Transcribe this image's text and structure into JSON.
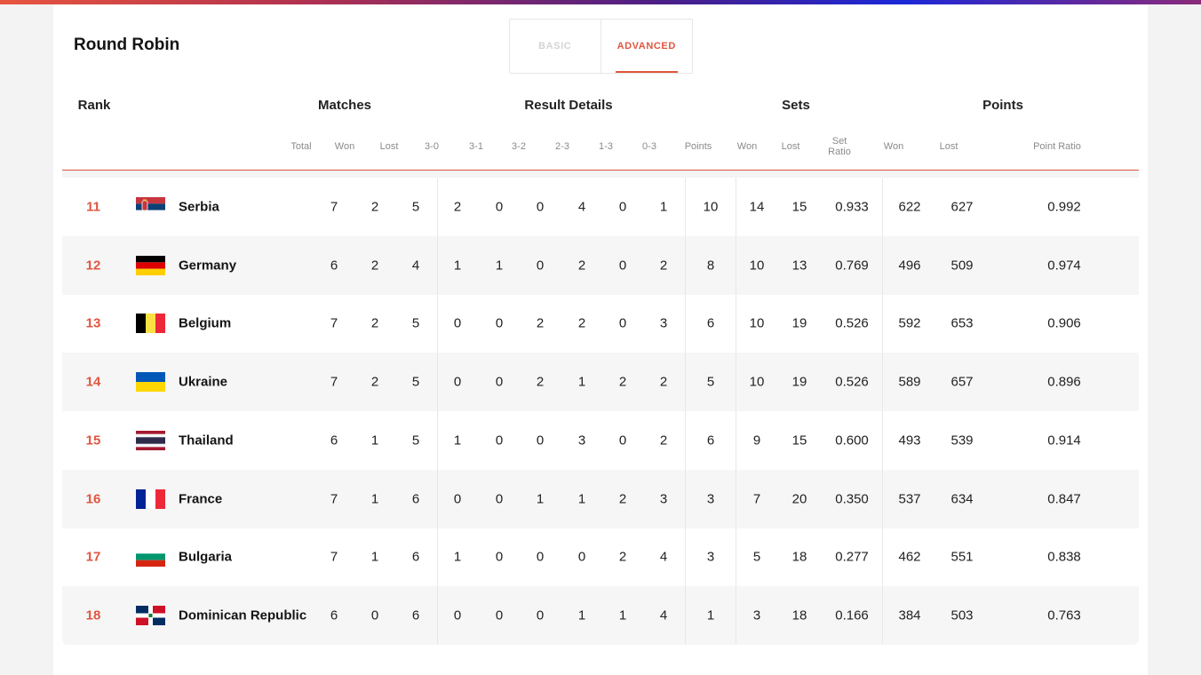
{
  "title": "Round Robin",
  "tabs": {
    "basic": "BASIC",
    "advanced": "ADVANCED"
  },
  "groups": {
    "rank": "Rank",
    "matches": "Matches",
    "result_details": "Result Details",
    "sets": "Sets",
    "points": "Points"
  },
  "columns": {
    "total": "Total",
    "won": "Won",
    "lost": "Lost",
    "r30": "3-0",
    "r31": "3-1",
    "r32": "3-2",
    "r23": "2-3",
    "r13": "1-3",
    "r03": "0-3",
    "points": "Points",
    "sets_won": "Won",
    "sets_lost": "Lost",
    "set_ratio_1": "Set",
    "set_ratio_2": "Ratio",
    "points_won": "Won",
    "points_lost": "Lost",
    "point_ratio": "Point Ratio"
  },
  "rows": [
    {
      "rank": "11",
      "flag": "serbia-flag-icon",
      "team": "Serbia",
      "total": "7",
      "won": "2",
      "lost": "5",
      "r30": "2",
      "r31": "0",
      "r32": "0",
      "r23": "4",
      "r13": "0",
      "r03": "1",
      "points": "10",
      "sets_won": "14",
      "sets_lost": "15",
      "set_ratio": "0.933",
      "points_won": "622",
      "points_lost": "627",
      "point_ratio": "0.992"
    },
    {
      "rank": "12",
      "flag": "germany-flag-icon",
      "team": "Germany",
      "total": "6",
      "won": "2",
      "lost": "4",
      "r30": "1",
      "r31": "1",
      "r32": "0",
      "r23": "2",
      "r13": "0",
      "r03": "2",
      "points": "8",
      "sets_won": "10",
      "sets_lost": "13",
      "set_ratio": "0.769",
      "points_won": "496",
      "points_lost": "509",
      "point_ratio": "0.974"
    },
    {
      "rank": "13",
      "flag": "belgium-flag-icon",
      "team": "Belgium",
      "total": "7",
      "won": "2",
      "lost": "5",
      "r30": "0",
      "r31": "0",
      "r32": "2",
      "r23": "2",
      "r13": "0",
      "r03": "3",
      "points": "6",
      "sets_won": "10",
      "sets_lost": "19",
      "set_ratio": "0.526",
      "points_won": "592",
      "points_lost": "653",
      "point_ratio": "0.906"
    },
    {
      "rank": "14",
      "flag": "ukraine-flag-icon",
      "team": "Ukraine",
      "total": "7",
      "won": "2",
      "lost": "5",
      "r30": "0",
      "r31": "0",
      "r32": "2",
      "r23": "1",
      "r13": "2",
      "r03": "2",
      "points": "5",
      "sets_won": "10",
      "sets_lost": "19",
      "set_ratio": "0.526",
      "points_won": "589",
      "points_lost": "657",
      "point_ratio": "0.896"
    },
    {
      "rank": "15",
      "flag": "thailand-flag-icon",
      "team": "Thailand",
      "total": "6",
      "won": "1",
      "lost": "5",
      "r30": "1",
      "r31": "0",
      "r32": "0",
      "r23": "3",
      "r13": "0",
      "r03": "2",
      "points": "6",
      "sets_won": "9",
      "sets_lost": "15",
      "set_ratio": "0.600",
      "points_won": "493",
      "points_lost": "539",
      "point_ratio": "0.914"
    },
    {
      "rank": "16",
      "flag": "france-flag-icon",
      "team": "France",
      "total": "7",
      "won": "1",
      "lost": "6",
      "r30": "0",
      "r31": "0",
      "r32": "1",
      "r23": "1",
      "r13": "2",
      "r03": "3",
      "points": "3",
      "sets_won": "7",
      "sets_lost": "20",
      "set_ratio": "0.350",
      "points_won": "537",
      "points_lost": "634",
      "point_ratio": "0.847"
    },
    {
      "rank": "17",
      "flag": "bulgaria-flag-icon",
      "team": "Bulgaria",
      "total": "7",
      "won": "1",
      "lost": "6",
      "r30": "1",
      "r31": "0",
      "r32": "0",
      "r23": "0",
      "r13": "2",
      "r03": "4",
      "points": "3",
      "sets_won": "5",
      "sets_lost": "18",
      "set_ratio": "0.277",
      "points_won": "462",
      "points_lost": "551",
      "point_ratio": "0.838"
    },
    {
      "rank": "18",
      "flag": "dominican-republic-flag-icon",
      "team": "Dominican Republic",
      "total": "6",
      "won": "0",
      "lost": "6",
      "r30": "0",
      "r31": "0",
      "r32": "0",
      "r23": "1",
      "r13": "1",
      "r03": "4",
      "points": "1",
      "sets_won": "3",
      "sets_lost": "18",
      "set_ratio": "0.166",
      "points_won": "384",
      "points_lost": "503",
      "point_ratio": "0.763"
    }
  ]
}
